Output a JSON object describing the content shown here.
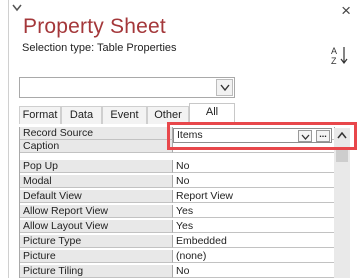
{
  "pane": {
    "title": "Property Sheet",
    "selection_type": "Selection type:  Table Properties",
    "close_glyph": "×"
  },
  "object_combo": {
    "value": ""
  },
  "tabs": [
    {
      "label": "Format",
      "active": false
    },
    {
      "label": "Data",
      "active": false
    },
    {
      "label": "Event",
      "active": false
    },
    {
      "label": "Other",
      "active": false
    },
    {
      "label": "All",
      "active": true
    }
  ],
  "properties": [
    {
      "name": "Record Source",
      "value": "Items"
    },
    {
      "name": "Caption",
      "value": ""
    },
    {
      "name": "Pop Up",
      "value": "No"
    },
    {
      "name": "Modal",
      "value": "No"
    },
    {
      "name": "Default View",
      "value": "Report View"
    },
    {
      "name": "Allow Report View",
      "value": "Yes"
    },
    {
      "name": "Allow Layout View",
      "value": "Yes"
    },
    {
      "name": "Picture Type",
      "value": "Embedded"
    },
    {
      "name": "Picture",
      "value": "(none)"
    },
    {
      "name": "Picture Tiling",
      "value": "No"
    }
  ],
  "record_source_builder_label": "...",
  "colors": {
    "title": "#a4373a",
    "highlight": "#e8474b",
    "label_bg": "#e8e8e8"
  }
}
